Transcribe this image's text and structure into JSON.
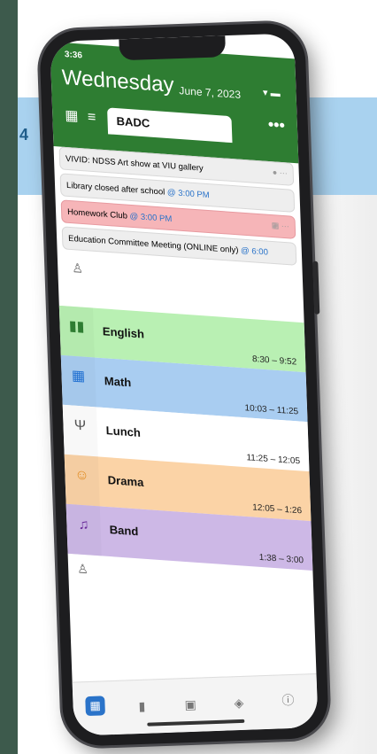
{
  "status": {
    "time": "3:36",
    "icons": "▾ ▬"
  },
  "header": {
    "day": "Wednesday",
    "date": "June 7, 2023",
    "tab_label": "BADC",
    "more": "•••"
  },
  "events": [
    {
      "title": "VIVID: NDSS Art show at VIU gallery",
      "time": "",
      "style": "gray"
    },
    {
      "title": "Library closed after school ",
      "time": "@ 3:00 PM",
      "style": "gray"
    },
    {
      "title": "Homework Club ",
      "time": "@ 3:00 PM",
      "style": "red"
    },
    {
      "title": "Education Committee Meeting (ONLINE only) ",
      "time": "@ 6:00",
      "style": "gray"
    }
  ],
  "periods": [
    {
      "name": "English",
      "range": "8:30 – 9:52",
      "color": "#b9f0b3",
      "icon": "book-icon",
      "glyph": "▮▮",
      "icon_color": "#2e7d32"
    },
    {
      "name": "Math",
      "range": "10:03 – 11:25",
      "color": "#a9cdf1",
      "icon": "grid-icon",
      "glyph": "▦",
      "icon_color": "#1f6fd1"
    },
    {
      "name": "Lunch",
      "range": "11:25 – 12:05",
      "color": "#ffffff",
      "icon": "utensils-icon",
      "glyph": "Ψ",
      "icon_color": "#555555"
    },
    {
      "name": "Drama",
      "range": "12:05 – 1:26",
      "color": "#fbd3a6",
      "icon": "masks-icon",
      "glyph": "☺",
      "icon_color": "#e08a1e"
    },
    {
      "name": "Band",
      "range": "1:38 – 3:00",
      "color": "#cdb8e6",
      "icon": "band-icon",
      "glyph": "♫",
      "icon_color": "#6a2a9a"
    }
  ],
  "colors": {
    "header": "#2e7d32",
    "link": "#2a73c9"
  }
}
